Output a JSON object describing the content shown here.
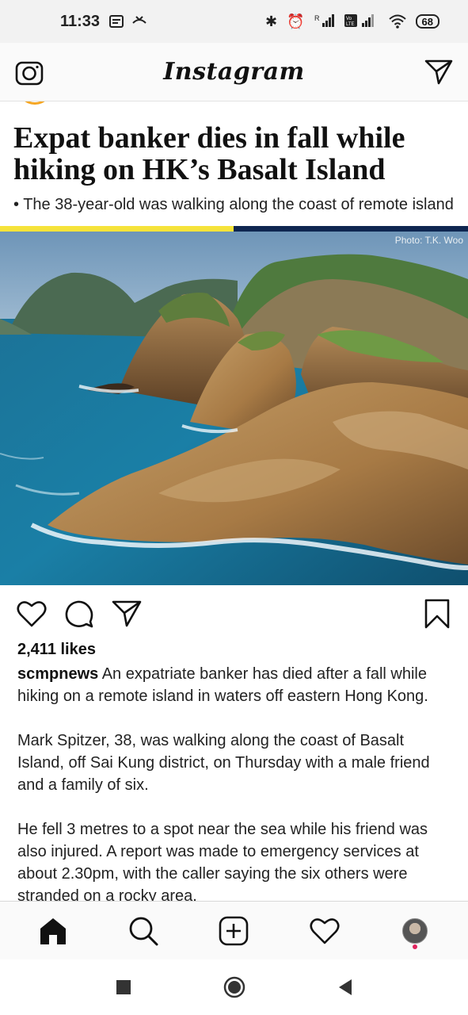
{
  "status_bar": {
    "time": "11:33",
    "battery": "68",
    "signal_label_1": "R",
    "signal_label_2": "Vo LTE"
  },
  "app": {
    "logo": "Instagram"
  },
  "article": {
    "headline": "Expat banker dies in fall while hiking on HK’s Basalt Island",
    "subhead": "• The 38-year-old was walking along the coast of remote island",
    "photo_credit": "Photo: T.K. Woo",
    "accent_colors": {
      "yellow": "#f6e33a",
      "navy": "#0f2650"
    }
  },
  "post": {
    "likes": "2,411 likes",
    "username": "scmpnews",
    "caption_first": "An expatriate banker has died after a fall while hiking on a remote island in waters off eastern Hong Kong.",
    "caption_p2": "Mark Spitzer, 38, was walking along the coast of Basalt Island, off Sai Kung district, on Thursday with a male friend and a family of six.",
    "caption_p3": "He fell 3 metres to a spot near the sea while his friend was also injured. A report was made to emergency services at about 2.30pm, with the caller saying the six others were stranded on a rocky area."
  },
  "icons": {
    "header_left": "camera-icon",
    "header_right": "direct-message-icon",
    "actions": [
      "heart-icon",
      "comment-icon",
      "share-icon",
      "bookmark-icon"
    ],
    "nav": [
      "home-icon",
      "search-icon",
      "add-post-icon",
      "activity-heart-icon",
      "profile-avatar"
    ]
  }
}
